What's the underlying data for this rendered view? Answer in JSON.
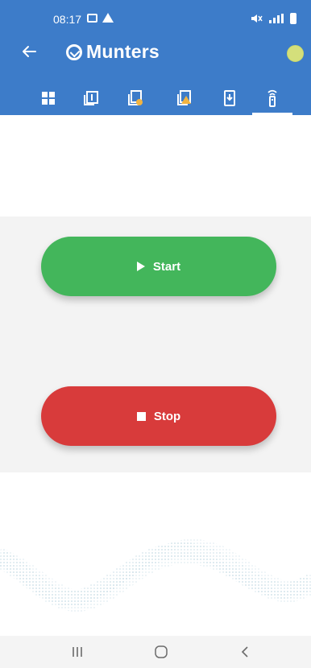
{
  "status_bar": {
    "time": "08:17",
    "left_icons": [
      "image-icon",
      "warning-icon"
    ],
    "right_icons": [
      "mute-icon",
      "signal-icon",
      "battery-icon"
    ]
  },
  "header": {
    "brand": "Munters",
    "status_color": "#d4df7b",
    "background_color": "#3d7cc9"
  },
  "tabs": [
    {
      "icon": "dashboard-grid-icon",
      "active": false
    },
    {
      "icon": "page-one-icon",
      "active": false
    },
    {
      "icon": "settings-panel-icon",
      "active": false
    },
    {
      "icon": "alert-panel-icon",
      "active": false
    },
    {
      "icon": "download-device-icon",
      "active": false
    },
    {
      "icon": "remote-control-icon",
      "active": true
    }
  ],
  "controls": {
    "start_label": "Start",
    "stop_label": "Stop",
    "start_color": "#43b65b",
    "stop_color": "#d83b3b"
  },
  "navigation": {
    "buttons": [
      "recent-apps-icon",
      "home-icon",
      "back-nav-icon"
    ]
  }
}
